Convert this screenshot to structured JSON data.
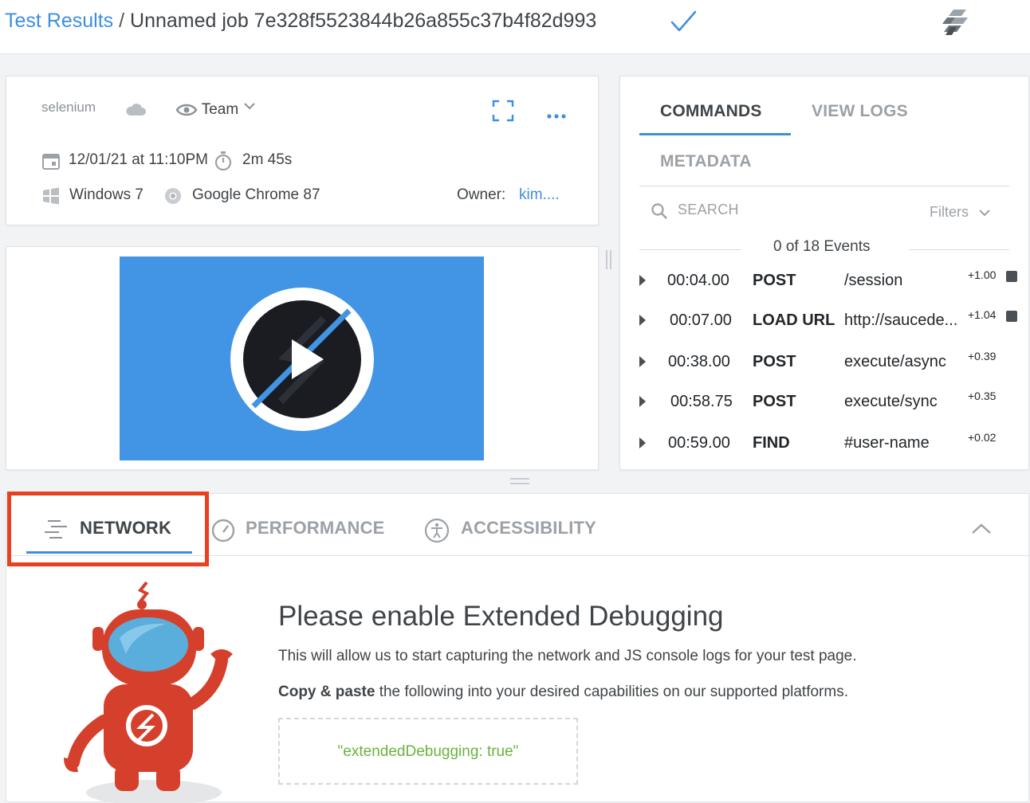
{
  "header": {
    "breadcrumb_link": "Test Results",
    "separator": " / ",
    "job_title": "Unnamed job 7e328f5523844b26a855c37b4f82d993",
    "status_icon": "check-icon",
    "brand_icon": "saucelabs-logo-icon"
  },
  "info": {
    "framework": "selenium",
    "cloud_icon": "cloud-icon",
    "visibility": "Team",
    "date": "12/01/21 at 11:10PM",
    "duration": "2m 45s",
    "os": "Windows 7",
    "browser": "Google Chrome 87",
    "owner_label": "Owner:",
    "owner_value": "kim...."
  },
  "commands_panel": {
    "tabs": [
      "COMMANDS",
      "VIEW LOGS",
      "METADATA"
    ],
    "search_placeholder": "SEARCH",
    "filters_label": "Filters",
    "events_count": "0 of 18 Events",
    "rows": [
      {
        "time": "00:04.00",
        "method": "POST",
        "path": "/session",
        "delta": "+1.00"
      },
      {
        "time": "00:07.00",
        "method": "LOAD URL",
        "path": "http://saucede...",
        "delta": "+1.04"
      },
      {
        "time": "00:38.00",
        "method": "POST",
        "path": "execute/async",
        "delta": "+0.39"
      },
      {
        "time": "00:58.75",
        "method": "POST",
        "path": "execute/sync",
        "delta": "+0.35"
      },
      {
        "time": "00:59.00",
        "method": "FIND",
        "path": "#user-name",
        "delta": "+0.02"
      }
    ]
  },
  "bottom_panel": {
    "tabs": [
      "NETWORK",
      "PERFORMANCE",
      "ACCESSIBILITY"
    ],
    "heading": "Please enable Extended Debugging",
    "description": "This will allow us to start capturing the network and JS console logs for your test page.",
    "copy_bold": "Copy & paste",
    "copy_rest": " the following into your desired capabilities on our supported platforms.",
    "code_snippet": "\"extendedDebugging: true\""
  },
  "colors": {
    "accent": "#3d8fe0",
    "video_bg": "#4294e4",
    "highlight": "#e8411f",
    "robot": "#d5402c",
    "code": "#6ab23e"
  }
}
